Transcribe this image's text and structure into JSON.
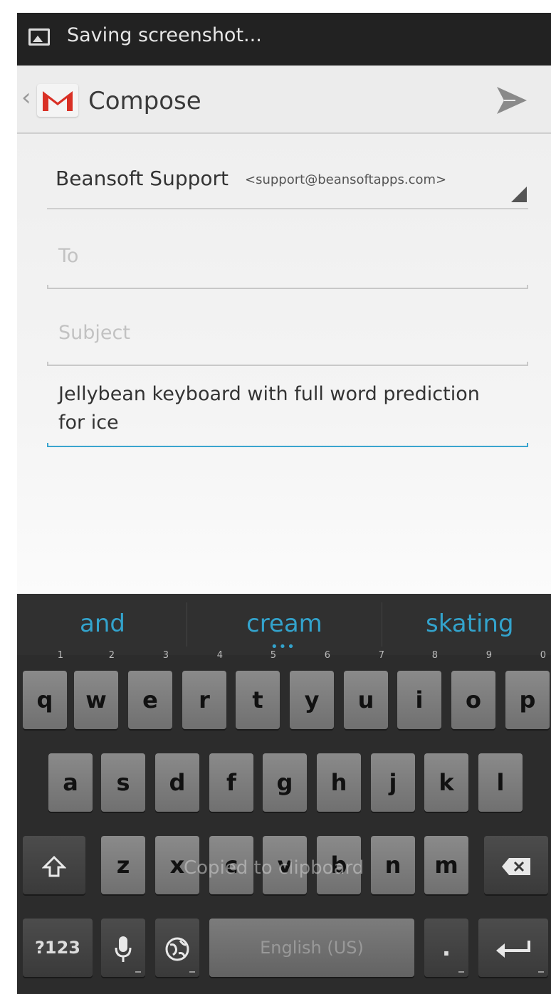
{
  "status_bar": {
    "notification_text": "Saving screenshot...",
    "icon": "image-icon"
  },
  "action_bar": {
    "title": "Compose",
    "app_icon": "gmail-icon",
    "back_icon": "chevron-left-icon",
    "send_icon": "send-icon"
  },
  "compose": {
    "from_name": "Beansoft Support",
    "from_email": "<support@beansoftapps.com>",
    "to_placeholder": "To",
    "subject_placeholder": "Subject",
    "body_text": "Jellybean keyboard with full word prediction for ice"
  },
  "keyboard": {
    "suggestions": [
      "and",
      "cream",
      "skating"
    ],
    "more_indicator": "•••",
    "row1": [
      {
        "label": "q",
        "hint": "1"
      },
      {
        "label": "w",
        "hint": "2"
      },
      {
        "label": "e",
        "hint": "3"
      },
      {
        "label": "r",
        "hint": "4"
      },
      {
        "label": "t",
        "hint": "5"
      },
      {
        "label": "y",
        "hint": "6"
      },
      {
        "label": "u",
        "hint": "7"
      },
      {
        "label": "i",
        "hint": "8"
      },
      {
        "label": "o",
        "hint": "9"
      },
      {
        "label": "p",
        "hint": "0"
      }
    ],
    "row2": [
      "a",
      "s",
      "d",
      "f",
      "g",
      "h",
      "j",
      "k",
      "l"
    ],
    "row3": [
      "z",
      "x",
      "c",
      "v",
      "b",
      "n",
      "m"
    ],
    "symbols_label": "?123",
    "space_label": "English (US)",
    "period_label": ".",
    "toast": "Copied to clipboard",
    "accent_color": "#33a3cc"
  }
}
